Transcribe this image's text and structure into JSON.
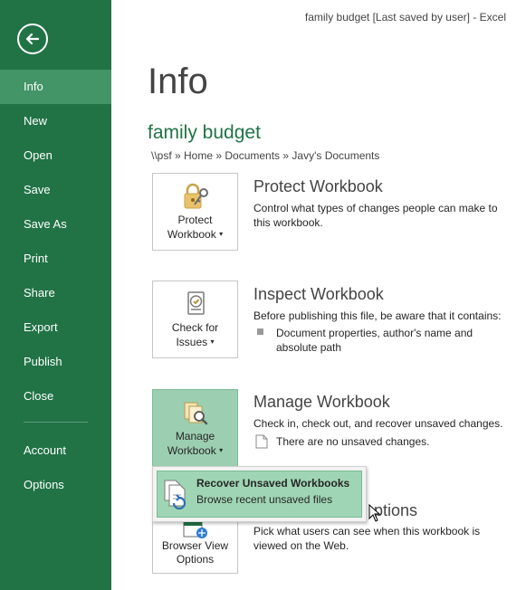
{
  "window": {
    "title": "family budget [Last saved by user] - Excel"
  },
  "nav": {
    "back_label": "Back",
    "items": [
      {
        "label": "Info",
        "active": true
      },
      {
        "label": "New"
      },
      {
        "label": "Open"
      },
      {
        "label": "Save"
      },
      {
        "label": "Save As"
      },
      {
        "label": "Print"
      },
      {
        "label": "Share"
      },
      {
        "label": "Export"
      },
      {
        "label": "Publish"
      },
      {
        "label": "Close"
      },
      {
        "label": "Account"
      },
      {
        "label": "Options"
      }
    ]
  },
  "page": {
    "title": "Info",
    "doc_name": "family budget",
    "breadcrumb": "\\\\psf » Home » Documents » Javy's Documents"
  },
  "protect": {
    "button_line1": "Protect",
    "button_line2": "Workbook",
    "heading": "Protect Workbook",
    "description": "Control what types of changes people can make to this workbook."
  },
  "inspect": {
    "button_line1": "Check for",
    "button_line2": "Issues",
    "heading": "Inspect Workbook",
    "description": "Before publishing this file, be aware that it contains:",
    "bullet": "Document properties, author's name and absolute path"
  },
  "manage": {
    "button_line1": "Manage",
    "button_line2": "Workbook",
    "heading": "Manage Workbook",
    "description": "Check in, check out, and recover unsaved changes.",
    "status": "There are no unsaved changes."
  },
  "browser": {
    "button_line1": "Browser View",
    "button_line2": "Options",
    "heading_visible": "ptions",
    "description": "Pick what users can see when this workbook is viewed on the Web."
  },
  "dropdown": {
    "item_title": "Recover Unsaved Workbooks",
    "item_subtitle": "Browse recent unsaved files"
  },
  "colors": {
    "sidebar": "#217346",
    "sidebar_active": "#439467",
    "accent_green": "#217346",
    "selected_button": "#9ccfb1"
  },
  "icons": {
    "back": "back-arrow-icon",
    "protect": "lock-key-icon",
    "inspect": "checklist-document-icon",
    "manage": "documents-magnifier-icon",
    "recover": "document-recover-icon",
    "browser": "browser-globe-icon",
    "status": "document-icon"
  }
}
